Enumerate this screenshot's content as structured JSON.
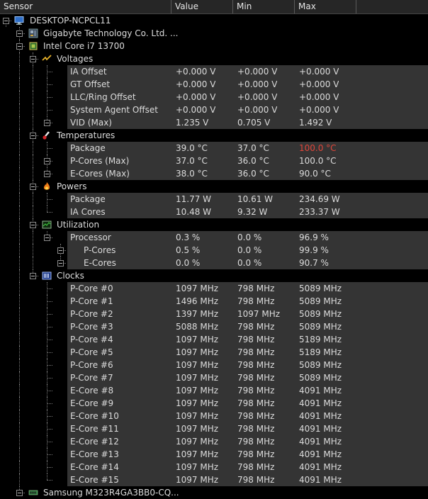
{
  "header": {
    "sensor": "Sensor",
    "value": "Value",
    "min": "Min",
    "max": "Max"
  },
  "colors": {
    "max_alarm": "#e0463a",
    "row_band": "#343434"
  },
  "rows": [
    {
      "label": "DESKTOP-NCPCL11",
      "icon": "computer-icon",
      "depth": 0,
      "kind": "computer"
    },
    {
      "label": "Gigabyte Technology Co. Ltd. ...",
      "icon": "motherboard-icon",
      "depth": 1,
      "kind": "motherboard"
    },
    {
      "label": "Intel Core i7 13700",
      "icon": "cpu-icon",
      "depth": 1,
      "kind": "cpu"
    },
    {
      "label": "Voltages",
      "icon": "voltage-icon",
      "depth": 2,
      "kind": "voltage"
    },
    {
      "label": "IA Offset",
      "depth": 3,
      "value": "+0.000 V",
      "min": "+0.000 V",
      "max": "+0.000 V"
    },
    {
      "label": "GT Offset",
      "depth": 3,
      "value": "+0.000 V",
      "min": "+0.000 V",
      "max": "+0.000 V"
    },
    {
      "label": "LLC/Ring Offset",
      "depth": 3,
      "value": "+0.000 V",
      "min": "+0.000 V",
      "max": "+0.000 V"
    },
    {
      "label": "System Agent Offset",
      "depth": 3,
      "value": "+0.000 V",
      "min": "+0.000 V",
      "max": "+0.000 V"
    },
    {
      "label": "VID (Max)",
      "depth": 3,
      "expander": true,
      "value": "1.235 V",
      "min": "0.705 V",
      "max": "1.492 V"
    },
    {
      "label": "Temperatures",
      "icon": "thermometer-icon",
      "depth": 2,
      "kind": "thermo"
    },
    {
      "label": "Package",
      "depth": 3,
      "value": "39.0 °C",
      "min": "37.0 °C",
      "max": "100.0 °C",
      "max_alarm": true
    },
    {
      "label": "P-Cores (Max)",
      "depth": 3,
      "expander": true,
      "value": "37.0 °C",
      "min": "36.0 °C",
      "max": "100.0 °C"
    },
    {
      "label": "E-Cores (Max)",
      "depth": 3,
      "expander": true,
      "value": "38.0 °C",
      "min": "36.0 °C",
      "max": "90.0 °C"
    },
    {
      "label": "Powers",
      "icon": "flame-icon",
      "depth": 2,
      "kind": "flame"
    },
    {
      "label": "Package",
      "depth": 3,
      "value": "11.77 W",
      "min": "10.61 W",
      "max": "234.69 W"
    },
    {
      "label": "IA Cores",
      "depth": 3,
      "value": "10.48 W",
      "min": "9.32 W",
      "max": "233.37 W"
    },
    {
      "label": "Utilization",
      "icon": "utilization-icon",
      "depth": 2,
      "kind": "util"
    },
    {
      "label": "Processor",
      "depth": 3,
      "expander": true,
      "value": "0.3 %",
      "min": "0.0 %",
      "max": "96.9 %"
    },
    {
      "label": "P-Cores",
      "depth": 4,
      "expander": true,
      "value": "0.5 %",
      "min": "0.0 %",
      "max": "99.9 %"
    },
    {
      "label": "E-Cores",
      "depth": 4,
      "expander": true,
      "value": "0.0 %",
      "min": "0.0 %",
      "max": "90.7 %"
    },
    {
      "label": "Clocks",
      "icon": "clock-icon",
      "depth": 2,
      "kind": "clock"
    },
    {
      "label": "P-Core #0",
      "depth": 3,
      "value": "1097 MHz",
      "min": "798 MHz",
      "max": "5089 MHz"
    },
    {
      "label": "P-Core #1",
      "depth": 3,
      "value": "1496 MHz",
      "min": "798 MHz",
      "max": "5089 MHz"
    },
    {
      "label": "P-Core #2",
      "depth": 3,
      "value": "1397 MHz",
      "min": "1097 MHz",
      "max": "5089 MHz"
    },
    {
      "label": "P-Core #3",
      "depth": 3,
      "value": "5088 MHz",
      "min": "798 MHz",
      "max": "5089 MHz"
    },
    {
      "label": "P-Core #4",
      "depth": 3,
      "value": "1097 MHz",
      "min": "798 MHz",
      "max": "5189 MHz"
    },
    {
      "label": "P-Core #5",
      "depth": 3,
      "value": "1097 MHz",
      "min": "798 MHz",
      "max": "5189 MHz"
    },
    {
      "label": "P-Core #6",
      "depth": 3,
      "value": "1097 MHz",
      "min": "798 MHz",
      "max": "5089 MHz"
    },
    {
      "label": "P-Core #7",
      "depth": 3,
      "value": "1097 MHz",
      "min": "798 MHz",
      "max": "5089 MHz"
    },
    {
      "label": "E-Core #8",
      "depth": 3,
      "value": "1097 MHz",
      "min": "798 MHz",
      "max": "4091 MHz"
    },
    {
      "label": "E-Core #9",
      "depth": 3,
      "value": "1097 MHz",
      "min": "798 MHz",
      "max": "4091 MHz"
    },
    {
      "label": "E-Core #10",
      "depth": 3,
      "value": "1097 MHz",
      "min": "798 MHz",
      "max": "4091 MHz"
    },
    {
      "label": "E-Core #11",
      "depth": 3,
      "value": "1097 MHz",
      "min": "798 MHz",
      "max": "4091 MHz"
    },
    {
      "label": "E-Core #12",
      "depth": 3,
      "value": "1097 MHz",
      "min": "798 MHz",
      "max": "4091 MHz"
    },
    {
      "label": "E-Core #13",
      "depth": 3,
      "value": "1097 MHz",
      "min": "798 MHz",
      "max": "4091 MHz"
    },
    {
      "label": "E-Core #14",
      "depth": 3,
      "value": "1097 MHz",
      "min": "798 MHz",
      "max": "4091 MHz"
    },
    {
      "label": "E-Core #15",
      "depth": 3,
      "value": "1097 MHz",
      "min": "798 MHz",
      "max": "4091 MHz"
    },
    {
      "label": "Samsung M323R4GA3BB0-CQ...",
      "icon": "memory-icon",
      "depth": 1,
      "kind": "ram"
    }
  ]
}
